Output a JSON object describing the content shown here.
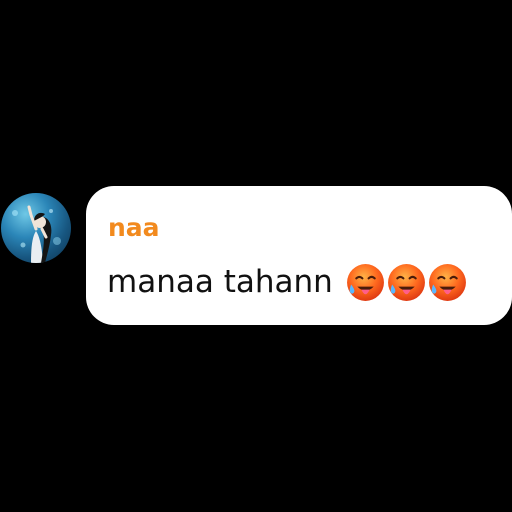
{
  "message": {
    "sender_name": "naa",
    "text": "manaa tahann",
    "emojis": [
      "hot-face-emoji",
      "hot-face-emoji",
      "hot-face-emoji"
    ]
  },
  "colors": {
    "background": "#000000",
    "bubble": "#ffffff",
    "sender_name": "#f28a1e",
    "message_text": "#111111"
  }
}
